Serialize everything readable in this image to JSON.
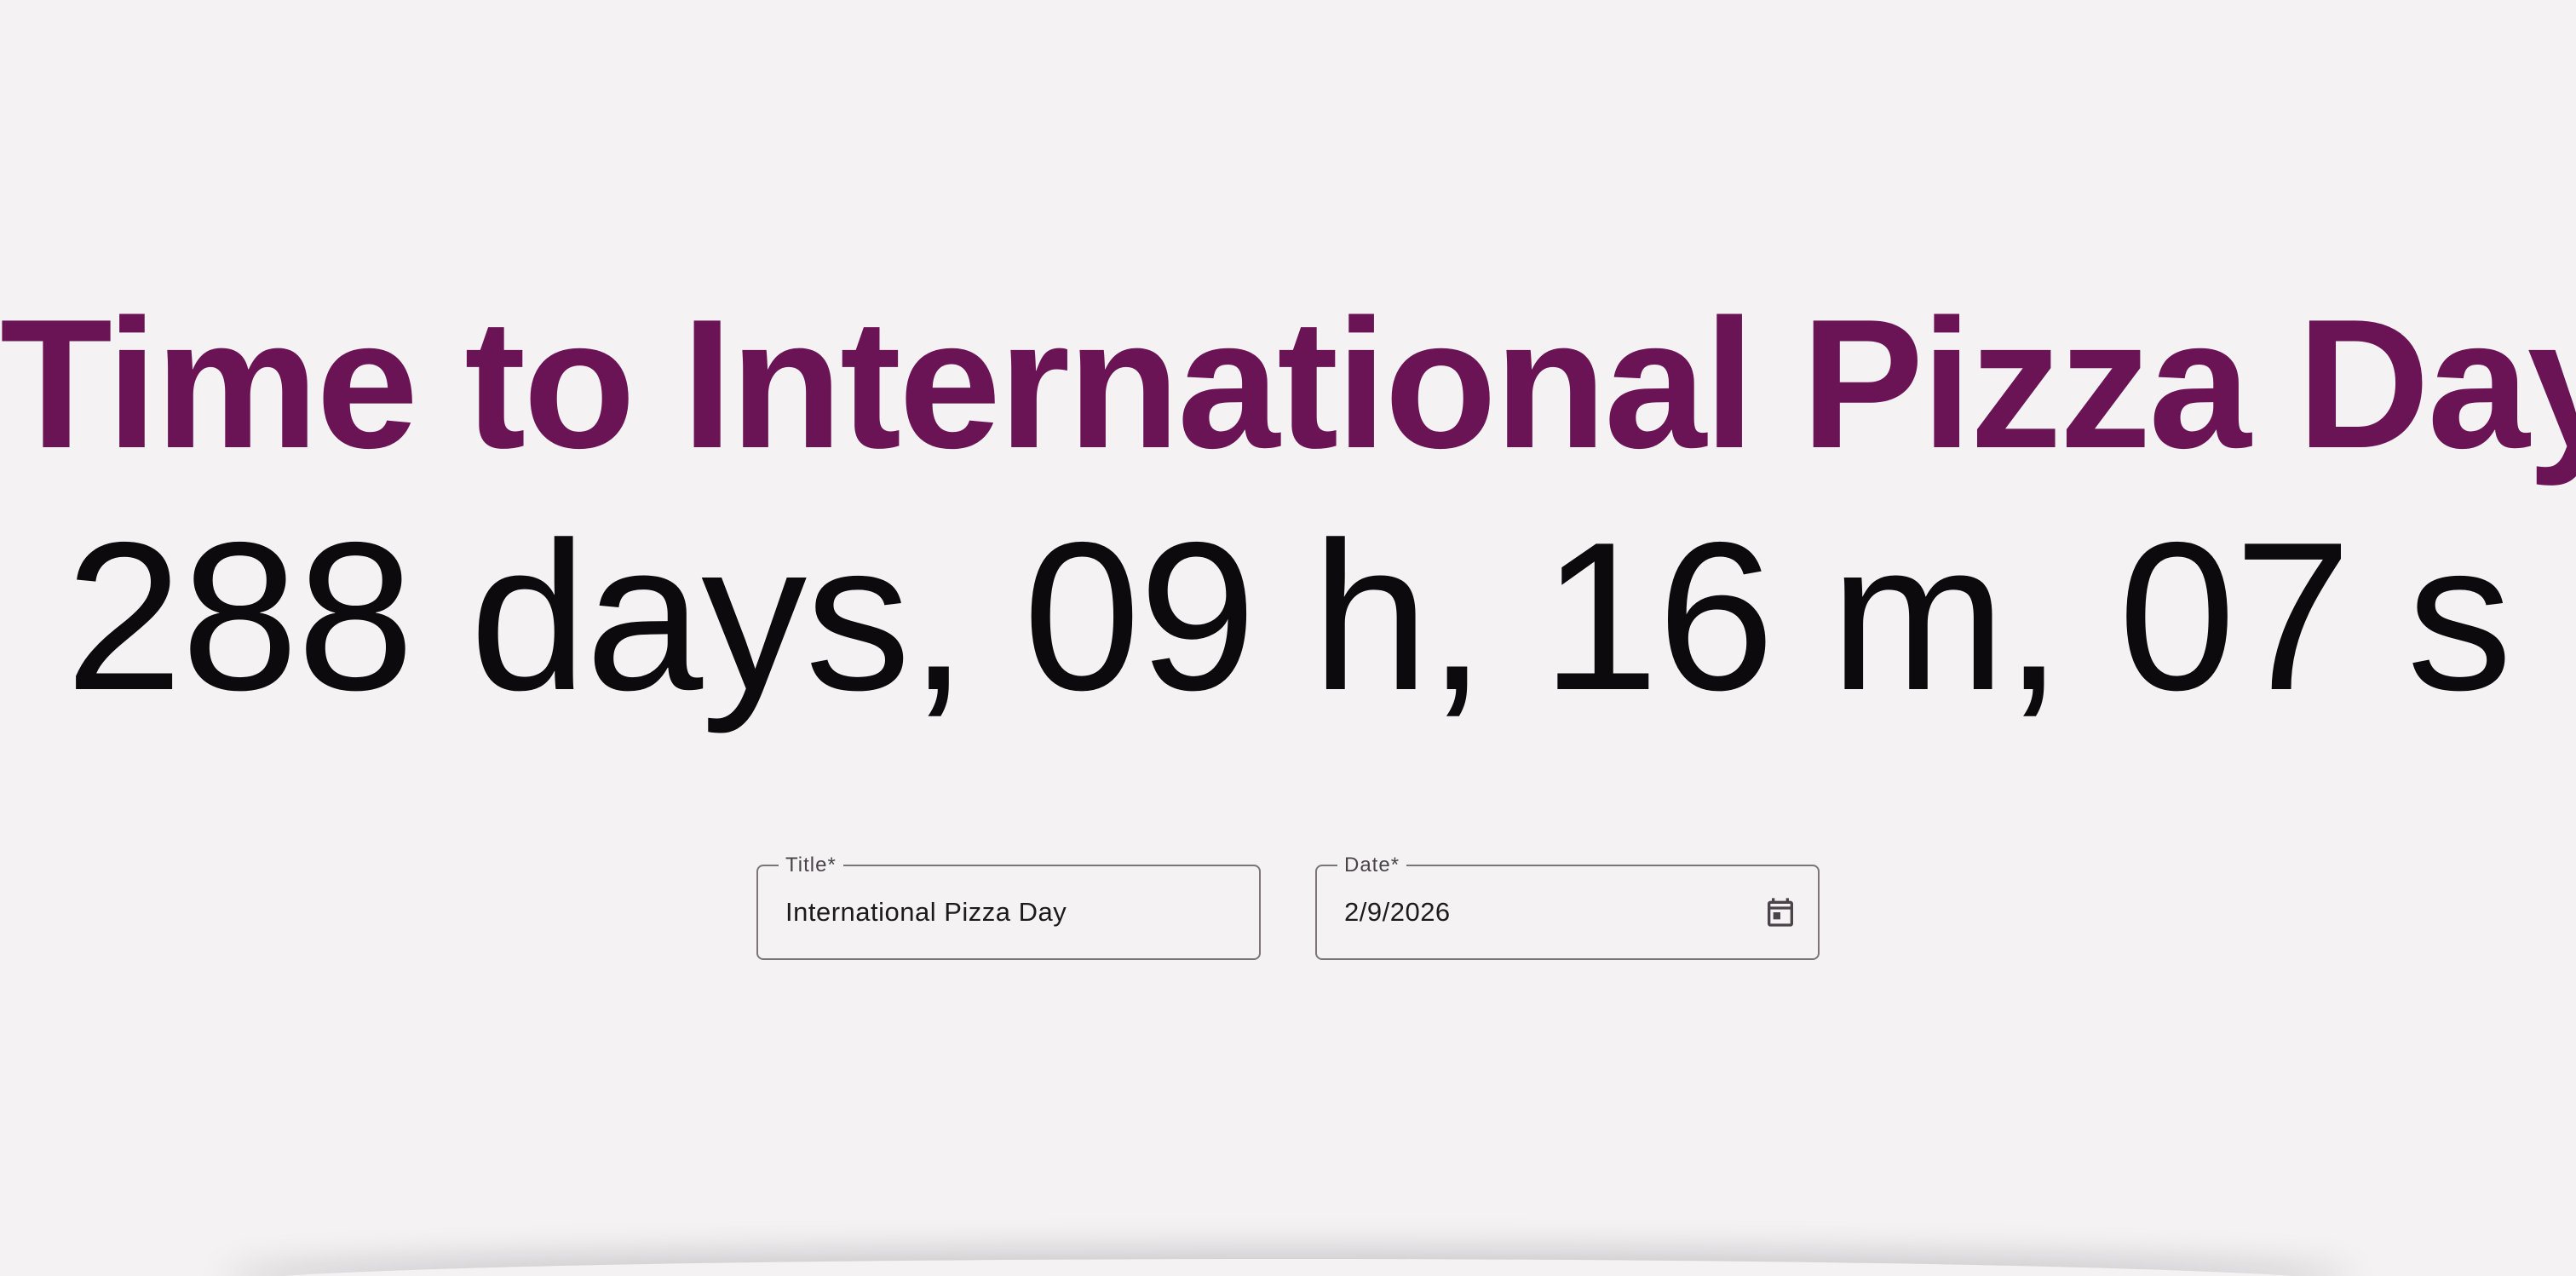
{
  "header": {
    "title": "Time to International Pizza Day"
  },
  "countdown": {
    "text": "288 days, 09 h, 16 m, 07 s"
  },
  "form": {
    "title_field": {
      "label": "Title*",
      "value": "International Pizza Day"
    },
    "date_field": {
      "label": "Date*",
      "value": "2/9/2026",
      "icon": "calendar-icon"
    }
  },
  "colors": {
    "accent": "#6a1456",
    "background": "#f5f2f4",
    "text": "#0c0a0c",
    "outline": "#7c7479"
  }
}
